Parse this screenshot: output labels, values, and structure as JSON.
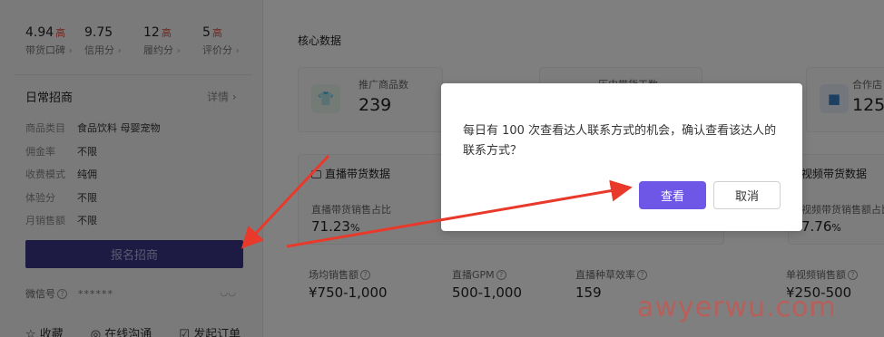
{
  "ratings": [
    {
      "value": "4.94",
      "tag": "高",
      "label": "带货口碑"
    },
    {
      "value": "9.75",
      "tag": "",
      "label": "信用分"
    },
    {
      "value": "12",
      "tag": "高",
      "label": "履约分"
    },
    {
      "value": "5",
      "tag": "高",
      "label": "评价分"
    }
  ],
  "daily": {
    "title": "日常招商",
    "detail_link": "详情 ›",
    "rows": [
      {
        "k": "商品类目",
        "v": "食品饮料 母婴宠物"
      },
      {
        "k": "佣金率",
        "v": "不限"
      },
      {
        "k": "收费模式",
        "v": "纯佣"
      },
      {
        "k": "体验分",
        "v": "不限"
      },
      {
        "k": "月销售额",
        "v": "不限"
      }
    ],
    "signup_button": "报名招商",
    "wechat_label": "微信号",
    "wechat_value": "******",
    "actions": [
      "☆ 收藏",
      "◎ 在线沟通",
      "☑ 发起订单"
    ]
  },
  "core": {
    "title": "核心数据",
    "cards": [
      {
        "label": "推广商品数",
        "value": "239"
      },
      {
        "label": "历史带货天数",
        "value": ""
      },
      {
        "label": "合作店",
        "value": "125"
      }
    ],
    "live_block": {
      "title": "直播带货数据",
      "share_label": "直播带货销售占比",
      "share_value": "71.23",
      "share_unit": "%"
    },
    "video_block": {
      "title": "视频带货数据",
      "share_label": "视频带货销售额占比",
      "share_value": "7.76",
      "share_unit": "%"
    },
    "bottom": [
      {
        "label": "场均销售额",
        "value": "¥750-1,000"
      },
      {
        "label": "直播GPM",
        "value": "500-1,000"
      },
      {
        "label": "直播种草效率",
        "value": "159"
      },
      {
        "label": "单视频销售额",
        "value": "¥250-500"
      }
    ]
  },
  "dialog": {
    "message": "每日有 100 次查看达人联系方式的机会，确认查看该达人的联系方式？",
    "confirm_label": "查看",
    "cancel_label": "取消"
  },
  "watermark": "awyerwu.com",
  "colors": {
    "primary": "#6e56e6",
    "signup_bg": "#3b3589",
    "arrow": "#e8392b",
    "tag_red": "#e34b3a"
  }
}
